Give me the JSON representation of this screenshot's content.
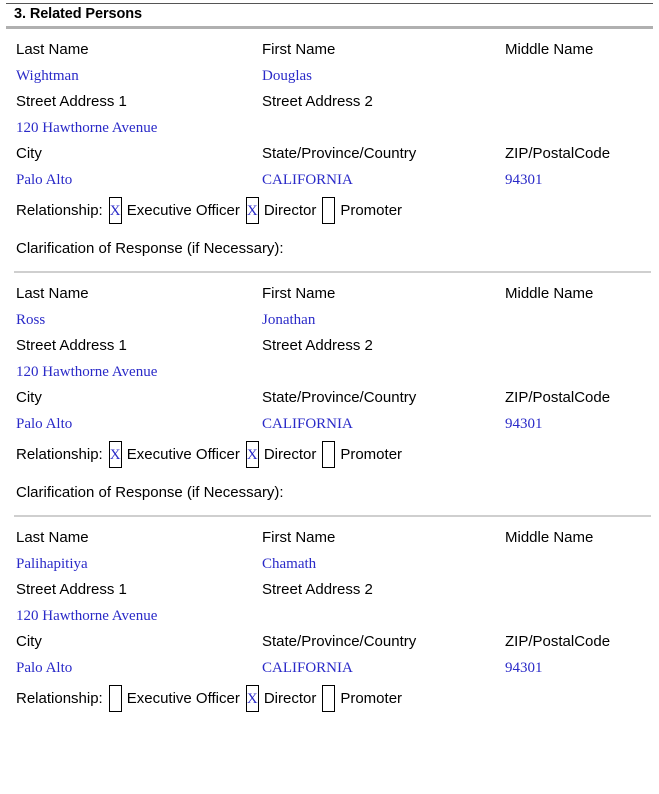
{
  "section": {
    "number": "3.",
    "title": "3. Related Persons"
  },
  "labels": {
    "last_name": "Last Name",
    "first_name": "First Name",
    "middle_name": "Middle Name",
    "street_address_1": "Street Address 1",
    "street_address_2": "Street Address 2",
    "city": "City",
    "state_province_country": "State/Province/Country",
    "zip_postal_code": "ZIP/PostalCode",
    "relationship": "Relationship:",
    "executive_officer": "Executive Officer",
    "director": "Director",
    "promoter": "Promoter",
    "clarification": "Clarification of Response (if Necessary):"
  },
  "colors": {
    "value_blue": "#2a2ac8",
    "label_black": "#000000",
    "divider_gray": "#cfcfcf",
    "header_rule_gray": "#b0b0b0"
  },
  "checkbox_marks": {
    "checked": "X",
    "unchecked": ""
  },
  "persons": [
    {
      "last_name": "Wightman",
      "first_name": "Douglas",
      "middle_name": "",
      "street_address_1": "120 Hawthorne Avenue",
      "street_address_2": "",
      "city": "Palo Alto",
      "state_province_country": "CALIFORNIA",
      "zip_postal_code": "94301",
      "relationship": {
        "executive_officer": "X",
        "director": "X",
        "promoter": ""
      },
      "clarification_value": ""
    },
    {
      "last_name": "Ross",
      "first_name": "Jonathan",
      "middle_name": "",
      "street_address_1": "120 Hawthorne Avenue",
      "street_address_2": "",
      "city": "Palo Alto",
      "state_province_country": "CALIFORNIA",
      "zip_postal_code": "94301",
      "relationship": {
        "executive_officer": "X",
        "director": "X",
        "promoter": ""
      },
      "clarification_value": ""
    },
    {
      "last_name": "Palihapitiya",
      "first_name": "Chamath",
      "middle_name": "",
      "street_address_1": "120 Hawthorne Avenue",
      "street_address_2": "",
      "city": "Palo Alto",
      "state_province_country": "CALIFORNIA",
      "zip_postal_code": "94301",
      "relationship": {
        "executive_officer": "",
        "director": "X",
        "promoter": ""
      },
      "clarification_value": ""
    }
  ]
}
